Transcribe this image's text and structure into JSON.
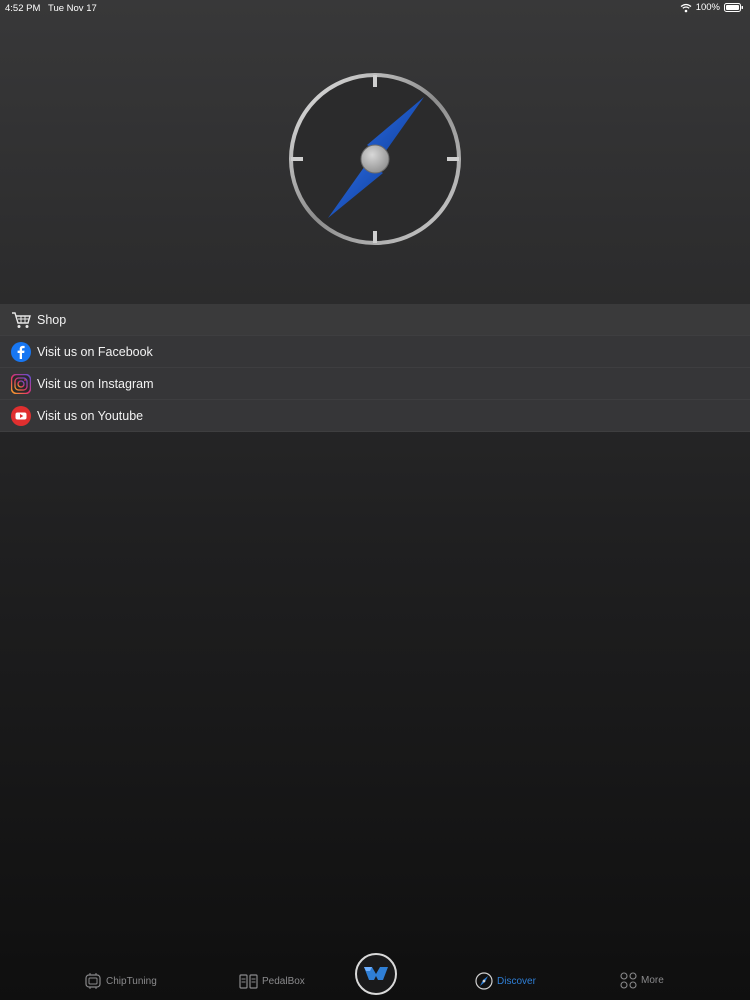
{
  "status_bar": {
    "time": "4:52 PM",
    "date": "Tue Nov 17",
    "battery": "100%"
  },
  "hero": {
    "icon": "compass-icon"
  },
  "menu": {
    "items": [
      {
        "label": "Shop",
        "icon": "cart-icon"
      },
      {
        "label": "Visit us on Facebook",
        "icon": "facebook-icon"
      },
      {
        "label": "Visit us on Instagram",
        "icon": "instagram-icon"
      },
      {
        "label": "Visit us on Youtube",
        "icon": "youtube-icon"
      }
    ]
  },
  "tabs": {
    "items": [
      {
        "label": "ChipTuning",
        "icon": "chip-icon",
        "active": false
      },
      {
        "label": "PedalBox",
        "icon": "pedalbox-icon",
        "active": false
      },
      {
        "label": "",
        "icon": "brand-logo-icon",
        "active": false
      },
      {
        "label": "Discover",
        "icon": "compass-small-icon",
        "active": true
      },
      {
        "label": "More",
        "icon": "grid-icon",
        "active": false
      }
    ]
  },
  "colors": {
    "accent": "#2f7fd6",
    "compass_needle": "#1e5bd0",
    "facebook": "#1877f2",
    "youtube": "#e02f2f",
    "inactive_tab": "#8a8a8c"
  }
}
